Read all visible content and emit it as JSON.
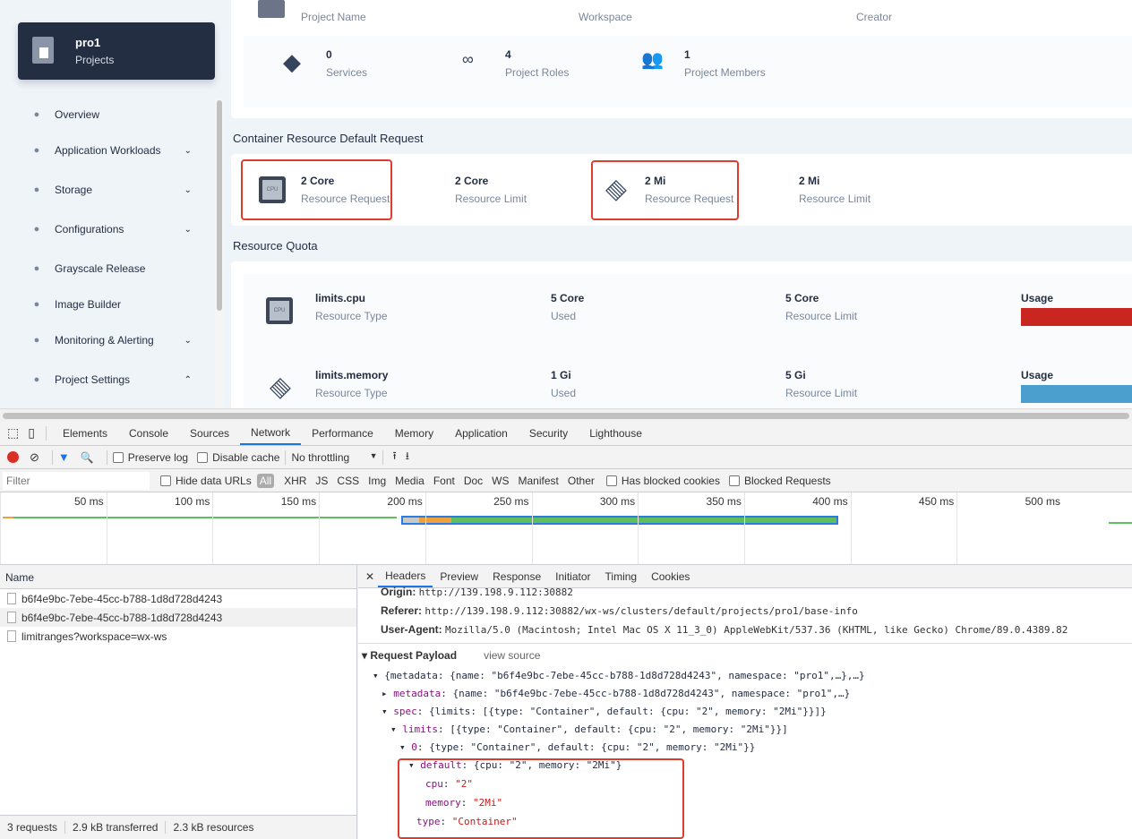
{
  "sidebar": {
    "project_name": "pro1",
    "project_type": "Projects",
    "items": [
      {
        "label": "Overview",
        "icon": "dashboard-icon",
        "chevron": ""
      },
      {
        "label": "Application Workloads",
        "icon": "layers-icon",
        "chevron": "⌄"
      },
      {
        "label": "Storage",
        "icon": "database-icon",
        "chevron": "⌄"
      },
      {
        "label": "Configurations",
        "icon": "hammer-icon",
        "chevron": "⌄"
      },
      {
        "label": "Grayscale Release",
        "icon": "bird-icon",
        "chevron": ""
      },
      {
        "label": "Image Builder",
        "icon": "image-icon",
        "chevron": ""
      },
      {
        "label": "Monitoring & Alerting",
        "icon": "monitor-icon",
        "chevron": "⌄"
      },
      {
        "label": "Project Settings",
        "icon": "gear-icon",
        "chevron": "⌃"
      }
    ]
  },
  "info": {
    "labels": [
      "Project Name",
      "Workspace",
      "Creator"
    ],
    "stats": [
      {
        "value": "0",
        "label": "Services"
      },
      {
        "value": "4",
        "label": "Project Roles"
      },
      {
        "value": "1",
        "label": "Project Members"
      }
    ]
  },
  "defaults": {
    "title": "Container Resource Default Request",
    "items": [
      {
        "value": "2 Core",
        "label": "Resource Request"
      },
      {
        "value": "2 Core",
        "label": "Resource Limit"
      },
      {
        "value": "2 Mi",
        "label": "Resource Request"
      },
      {
        "value": "2 Mi",
        "label": "Resource Limit"
      }
    ]
  },
  "quota": {
    "title": "Resource Quota",
    "rows": [
      {
        "name": "limits.cpu",
        "type_label": "Resource Type",
        "used": "5 Core",
        "used_label": "Used",
        "limit": "5 Core",
        "limit_label": "Resource Limit",
        "usage_label": "Usage",
        "usage_color": "#ca2621",
        "usage_percent": 100
      },
      {
        "name": "limits.memory",
        "type_label": "Resource Type",
        "used": "1 Gi",
        "used_label": "Used",
        "limit": "5 Gi",
        "limit_label": "Resource Limit",
        "usage_label": "Usage",
        "usage_color": "#55bc8a",
        "usage_percent": 20
      }
    ]
  },
  "devtools": {
    "tabs": [
      "Elements",
      "Console",
      "Sources",
      "Network",
      "Performance",
      "Memory",
      "Application",
      "Security",
      "Lighthouse"
    ],
    "active_tab": "Network",
    "toolbar": {
      "preserve_log": "Preserve log",
      "disable_cache": "Disable cache",
      "throttling": "No throttling"
    },
    "filter": {
      "placeholder": "Filter",
      "hide_data_urls": "Hide data URLs",
      "types": [
        "All",
        "XHR",
        "JS",
        "CSS",
        "Img",
        "Media",
        "Font",
        "Doc",
        "WS",
        "Manifest",
        "Other"
      ],
      "has_blocked": "Has blocked cookies",
      "blocked_requests": "Blocked Requests"
    },
    "timeline": [
      "50 ms",
      "100 ms",
      "150 ms",
      "200 ms",
      "250 ms",
      "300 ms",
      "350 ms",
      "400 ms",
      "450 ms",
      "500 ms"
    ],
    "name_header": "Name",
    "requests": [
      "b6f4e9bc-7ebe-45cc-b788-1d8d728d4243",
      "b6f4e9bc-7ebe-45cc-b788-1d8d728d4243",
      "limitranges?workspace=wx-ws"
    ],
    "status": [
      "3 requests",
      "2.9 kB transferred",
      "2.3 kB resources"
    ],
    "detail_tabs": [
      "Headers",
      "Preview",
      "Response",
      "Initiator",
      "Timing",
      "Cookies"
    ],
    "headers": [
      {
        "k": "Origin:",
        "v": "http://139.198.9.112:30882"
      },
      {
        "k": "Referer:",
        "v": "http://139.198.9.112:30882/wx-ws/clusters/default/projects/pro1/base-info"
      },
      {
        "k": "User-Agent:",
        "v": "Mozilla/5.0 (Macintosh; Intel Mac OS X 11_3_0) AppleWebKit/537.36 (KHTML, like Gecko) Chrome/89.0.4389.82"
      }
    ],
    "payload_title": "Request Payload",
    "view_source": "view source",
    "payload": {
      "root": "{metadata: {name: \"b6f4e9bc-7ebe-45cc-b788-1d8d728d4243\", namespace: \"pro1\",…},…}",
      "metadata_k": "metadata",
      "metadata_v": ": {name: \"b6f4e9bc-7ebe-45cc-b788-1d8d728d4243\", namespace: \"pro1\",…}",
      "spec_k": "spec",
      "spec_v": ": {limits: [{type: \"Container\", default: {cpu: \"2\", memory: \"2Mi\"}}]}",
      "limits_k": "limits",
      "limits_v": ": [{type: \"Container\", default: {cpu: \"2\", memory: \"2Mi\"}}]",
      "zero_k": "0",
      "zero_v": ": {type: \"Container\", default: {cpu: \"2\", memory: \"2Mi\"}}",
      "default_k": "default",
      "default_v": ": {cpu: \"2\", memory: \"2Mi\"}",
      "cpu_k": "cpu",
      "cpu_v": "\"2\"",
      "memory_k": "memory",
      "memory_v": "\"2Mi\"",
      "type_k": "type",
      "type_v": "\"Container\""
    }
  }
}
